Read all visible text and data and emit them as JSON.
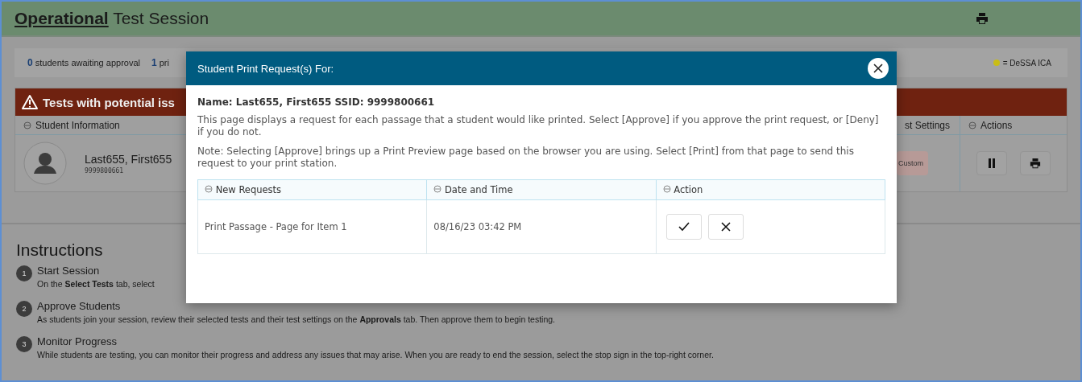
{
  "header": {
    "title_bold": "Operational",
    "title_rest": "Test Session"
  },
  "stats": {
    "items": [
      {
        "count": "0",
        "label": "students awaiting approval"
      },
      {
        "count": "1",
        "label": "pri"
      }
    ],
    "legend": "= DeSSA ICA"
  },
  "issues": {
    "title": "Tests with potential iss",
    "columns": [
      {
        "label": "Student Information",
        "sort_icon": true
      },
      {
        "label": "st Settings",
        "sort_icon": false
      },
      {
        "label": "Actions",
        "sort_icon": true
      }
    ],
    "rows": [
      {
        "name": "Last655, First655",
        "ssid": "9999800661",
        "settings": "Custom"
      }
    ]
  },
  "instructions": {
    "title": "Instructions",
    "steps": [
      {
        "number": "1",
        "title": "Start Session",
        "text": "On the **Select Tests** tab, select"
      },
      {
        "number": "2",
        "title": "Approve Students",
        "text": "As students join your session, review their selected tests and their test settings on the **Approvals** tab. Then approve them to begin testing."
      },
      {
        "number": "3",
        "title": "Monitor Progress",
        "text": "While students are testing, you can monitor their progress and address any issues that may arise. When you are ready to end the session, select the stop sign in the top-right corner."
      }
    ]
  },
  "modal": {
    "title": "Student Print Request(s) For:",
    "student": "Name: Last655, First655 SSID: 9999800661",
    "paragraphs": [
      "This page displays a request for each passage that a student would like printed. Select [Approve] if you approve the print request, or [Deny] if you do not.",
      "Note: Selecting [Approve] brings up a Print Preview page based on the browser you are using. Select [Print] from that page to send this request to your print station."
    ],
    "table": {
      "columns": [
        "New Requests",
        "Date and Time",
        "Action"
      ],
      "rows": [
        {
          "request": "Print Passage - Page for Item 1",
          "time": "08/16/23 03:42 PM"
        }
      ]
    }
  }
}
